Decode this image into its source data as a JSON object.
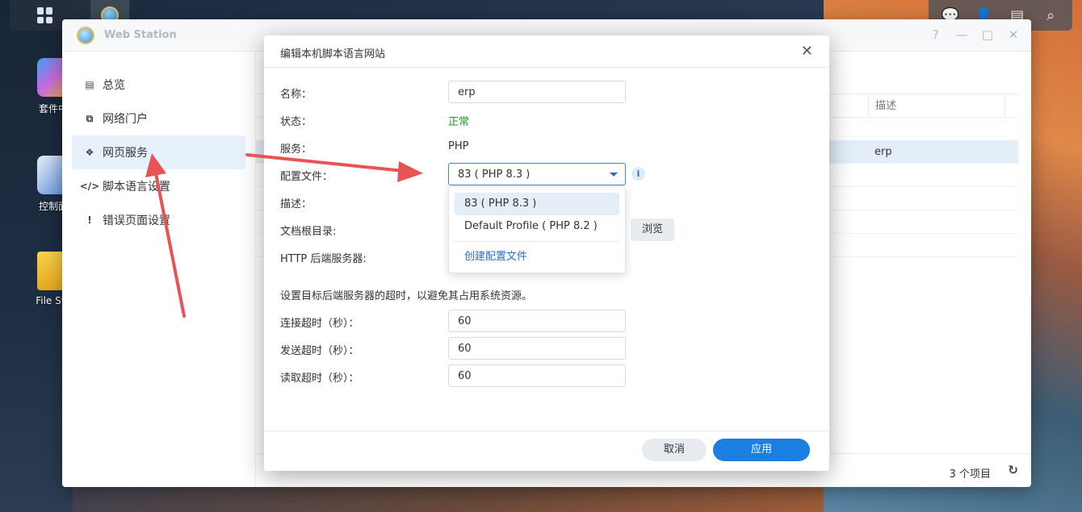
{
  "desktop": {
    "icons": [
      {
        "label": "套件中",
        "icon": "package-center-icon"
      },
      {
        "label": "控制面",
        "icon": "control-panel-icon"
      },
      {
        "label": "File Sta",
        "icon": "file-station-icon"
      }
    ]
  },
  "taskbar": {
    "left_icons": [
      "main-menu-icon",
      "web-station-icon"
    ],
    "right_icons": [
      "chat-icon",
      "user-icon",
      "widgets-icon",
      "search-icon"
    ]
  },
  "window": {
    "title": "Web Station",
    "controls": {
      "help": "?",
      "minimize": "—",
      "maximize": "□",
      "close": "✕"
    },
    "sidebar": {
      "items": [
        {
          "label": "总览",
          "icon": "overview-icon"
        },
        {
          "label": "网络门户",
          "icon": "portal-icon"
        },
        {
          "label": "网页服务",
          "icon": "web-service-icon",
          "active": true
        },
        {
          "label": "脚本语言设置",
          "icon": "code-icon"
        },
        {
          "label": "错误页面设置",
          "icon": "error-page-icon"
        }
      ]
    },
    "table": {
      "header_desc": "描述",
      "selected_row_desc": "erp",
      "count": "3 个项目"
    }
  },
  "modal": {
    "title": "编辑本机脚本语言网站",
    "fields": {
      "name_label": "名称：",
      "name_value": "erp",
      "status_label": "状态：",
      "status_value": "正常",
      "service_label": "服务：",
      "service_value": "PHP",
      "profile_label": "配置文件：",
      "profile_value": "83 ( PHP 8.3 )",
      "desc_label": "描述：",
      "docroot_label": "文档根目录:",
      "http_label": "HTTP 后端服务器:",
      "browse": "浏览"
    },
    "dropdown": {
      "options": [
        "83 ( PHP 8.3 )",
        "Default Profile ( PHP 8.2 )"
      ],
      "create": "创建配置文件"
    },
    "timeout_hint": "设置目标后端服务器的超时，以避免其占用系统资源。",
    "timeouts": [
      {
        "label": "连接超时（秒）：",
        "value": "60"
      },
      {
        "label": "发送超时（秒）：",
        "value": "60"
      },
      {
        "label": "读取超时（秒）：",
        "value": "60"
      }
    ],
    "buttons": {
      "cancel": "取消",
      "apply": "应用"
    }
  },
  "colors": {
    "accent": "#1a7fe0",
    "ok": "#1a9a2a",
    "arrow": "#e85454"
  }
}
